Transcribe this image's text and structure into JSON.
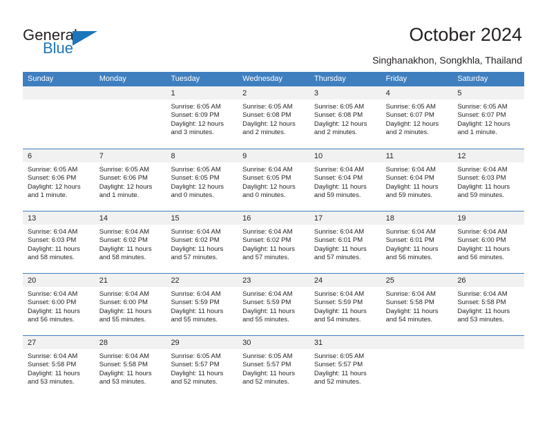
{
  "brand": {
    "word1": "General",
    "word2": "Blue",
    "accent_color": "#1b75bb"
  },
  "header": {
    "title": "October 2024",
    "subtitle": "Singhanakhon, Songkhla, Thailand"
  },
  "calendar": {
    "header_bg": "#3f7fbf",
    "day_band_bg": "#f1f1f1",
    "weekdays": [
      "Sunday",
      "Monday",
      "Tuesday",
      "Wednesday",
      "Thursday",
      "Friday",
      "Saturday"
    ],
    "weeks": [
      [
        {
          "day": "",
          "lines": []
        },
        {
          "day": "",
          "lines": []
        },
        {
          "day": "1",
          "lines": [
            "Sunrise: 6:05 AM",
            "Sunset: 6:09 PM",
            "Daylight: 12 hours",
            "and 3 minutes."
          ]
        },
        {
          "day": "2",
          "lines": [
            "Sunrise: 6:05 AM",
            "Sunset: 6:08 PM",
            "Daylight: 12 hours",
            "and 2 minutes."
          ]
        },
        {
          "day": "3",
          "lines": [
            "Sunrise: 6:05 AM",
            "Sunset: 6:08 PM",
            "Daylight: 12 hours",
            "and 2 minutes."
          ]
        },
        {
          "day": "4",
          "lines": [
            "Sunrise: 6:05 AM",
            "Sunset: 6:07 PM",
            "Daylight: 12 hours",
            "and 2 minutes."
          ]
        },
        {
          "day": "5",
          "lines": [
            "Sunrise: 6:05 AM",
            "Sunset: 6:07 PM",
            "Daylight: 12 hours",
            "and 1 minute."
          ]
        }
      ],
      [
        {
          "day": "6",
          "lines": [
            "Sunrise: 6:05 AM",
            "Sunset: 6:06 PM",
            "Daylight: 12 hours",
            "and 1 minute."
          ]
        },
        {
          "day": "7",
          "lines": [
            "Sunrise: 6:05 AM",
            "Sunset: 6:06 PM",
            "Daylight: 12 hours",
            "and 1 minute."
          ]
        },
        {
          "day": "8",
          "lines": [
            "Sunrise: 6:05 AM",
            "Sunset: 6:05 PM",
            "Daylight: 12 hours",
            "and 0 minutes."
          ]
        },
        {
          "day": "9",
          "lines": [
            "Sunrise: 6:04 AM",
            "Sunset: 6:05 PM",
            "Daylight: 12 hours",
            "and 0 minutes."
          ]
        },
        {
          "day": "10",
          "lines": [
            "Sunrise: 6:04 AM",
            "Sunset: 6:04 PM",
            "Daylight: 11 hours",
            "and 59 minutes."
          ]
        },
        {
          "day": "11",
          "lines": [
            "Sunrise: 6:04 AM",
            "Sunset: 6:04 PM",
            "Daylight: 11 hours",
            "and 59 minutes."
          ]
        },
        {
          "day": "12",
          "lines": [
            "Sunrise: 6:04 AM",
            "Sunset: 6:03 PM",
            "Daylight: 11 hours",
            "and 59 minutes."
          ]
        }
      ],
      [
        {
          "day": "13",
          "lines": [
            "Sunrise: 6:04 AM",
            "Sunset: 6:03 PM",
            "Daylight: 11 hours",
            "and 58 minutes."
          ]
        },
        {
          "day": "14",
          "lines": [
            "Sunrise: 6:04 AM",
            "Sunset: 6:02 PM",
            "Daylight: 11 hours",
            "and 58 minutes."
          ]
        },
        {
          "day": "15",
          "lines": [
            "Sunrise: 6:04 AM",
            "Sunset: 6:02 PM",
            "Daylight: 11 hours",
            "and 57 minutes."
          ]
        },
        {
          "day": "16",
          "lines": [
            "Sunrise: 6:04 AM",
            "Sunset: 6:02 PM",
            "Daylight: 11 hours",
            "and 57 minutes."
          ]
        },
        {
          "day": "17",
          "lines": [
            "Sunrise: 6:04 AM",
            "Sunset: 6:01 PM",
            "Daylight: 11 hours",
            "and 57 minutes."
          ]
        },
        {
          "day": "18",
          "lines": [
            "Sunrise: 6:04 AM",
            "Sunset: 6:01 PM",
            "Daylight: 11 hours",
            "and 56 minutes."
          ]
        },
        {
          "day": "19",
          "lines": [
            "Sunrise: 6:04 AM",
            "Sunset: 6:00 PM",
            "Daylight: 11 hours",
            "and 56 minutes."
          ]
        }
      ],
      [
        {
          "day": "20",
          "lines": [
            "Sunrise: 6:04 AM",
            "Sunset: 6:00 PM",
            "Daylight: 11 hours",
            "and 56 minutes."
          ]
        },
        {
          "day": "21",
          "lines": [
            "Sunrise: 6:04 AM",
            "Sunset: 6:00 PM",
            "Daylight: 11 hours",
            "and 55 minutes."
          ]
        },
        {
          "day": "22",
          "lines": [
            "Sunrise: 6:04 AM",
            "Sunset: 5:59 PM",
            "Daylight: 11 hours",
            "and 55 minutes."
          ]
        },
        {
          "day": "23",
          "lines": [
            "Sunrise: 6:04 AM",
            "Sunset: 5:59 PM",
            "Daylight: 11 hours",
            "and 55 minutes."
          ]
        },
        {
          "day": "24",
          "lines": [
            "Sunrise: 6:04 AM",
            "Sunset: 5:59 PM",
            "Daylight: 11 hours",
            "and 54 minutes."
          ]
        },
        {
          "day": "25",
          "lines": [
            "Sunrise: 6:04 AM",
            "Sunset: 5:58 PM",
            "Daylight: 11 hours",
            "and 54 minutes."
          ]
        },
        {
          "day": "26",
          "lines": [
            "Sunrise: 6:04 AM",
            "Sunset: 5:58 PM",
            "Daylight: 11 hours",
            "and 53 minutes."
          ]
        }
      ],
      [
        {
          "day": "27",
          "lines": [
            "Sunrise: 6:04 AM",
            "Sunset: 5:58 PM",
            "Daylight: 11 hours",
            "and 53 minutes."
          ]
        },
        {
          "day": "28",
          "lines": [
            "Sunrise: 6:04 AM",
            "Sunset: 5:58 PM",
            "Daylight: 11 hours",
            "and 53 minutes."
          ]
        },
        {
          "day": "29",
          "lines": [
            "Sunrise: 6:05 AM",
            "Sunset: 5:57 PM",
            "Daylight: 11 hours",
            "and 52 minutes."
          ]
        },
        {
          "day": "30",
          "lines": [
            "Sunrise: 6:05 AM",
            "Sunset: 5:57 PM",
            "Daylight: 11 hours",
            "and 52 minutes."
          ]
        },
        {
          "day": "31",
          "lines": [
            "Sunrise: 6:05 AM",
            "Sunset: 5:57 PM",
            "Daylight: 11 hours",
            "and 52 minutes."
          ]
        },
        {
          "day": "",
          "lines": []
        },
        {
          "day": "",
          "lines": []
        }
      ]
    ]
  }
}
